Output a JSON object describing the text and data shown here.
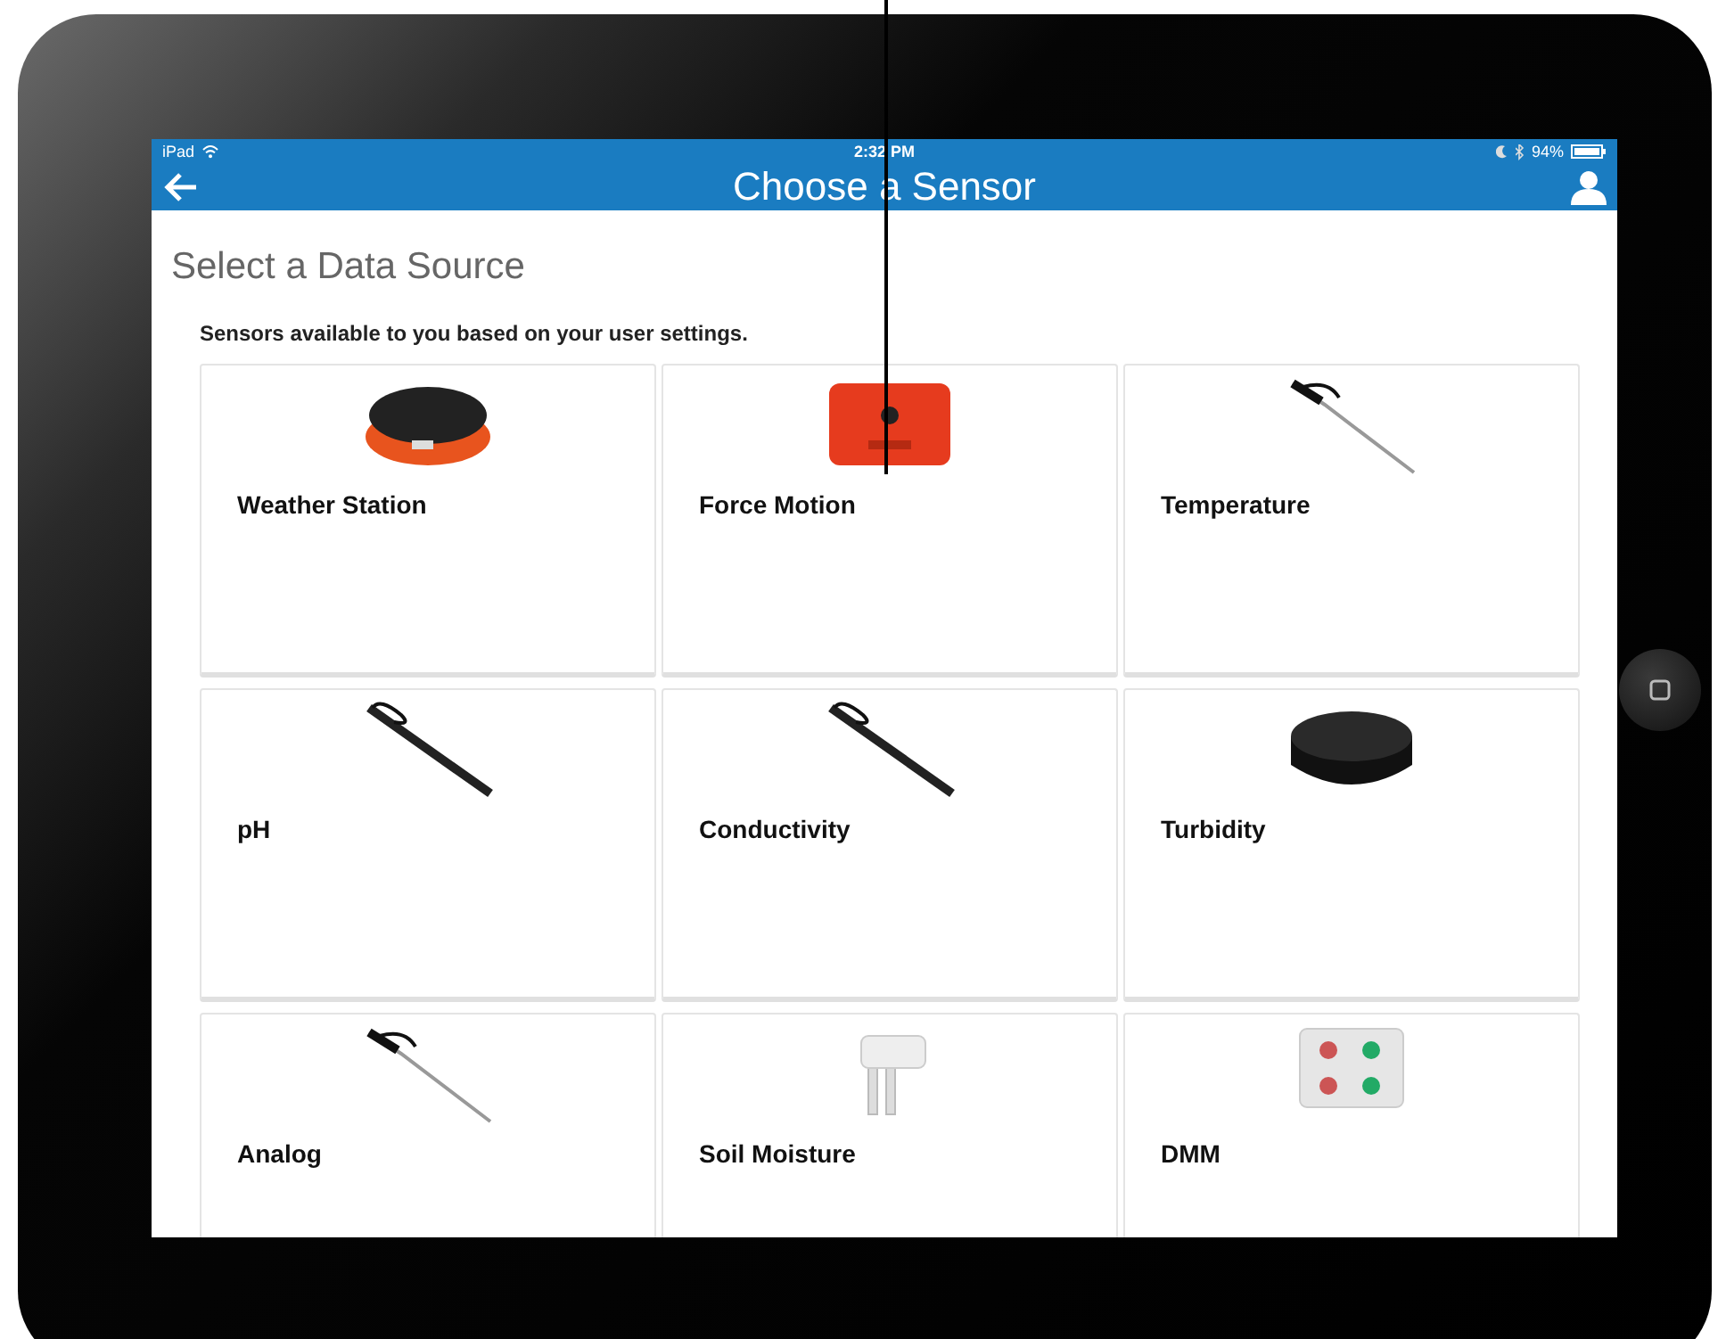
{
  "status_bar": {
    "device": "iPad",
    "time": "2:32 PM",
    "battery": "94%"
  },
  "header": {
    "title": "Choose a Sensor"
  },
  "page": {
    "title": "Select a Data Source",
    "subtitle": "Sensors available to you based on your user settings."
  },
  "sensors": [
    {
      "name": "Weather Station",
      "kind": "hub"
    },
    {
      "name": "Force Motion",
      "kind": "block"
    },
    {
      "name": "Temperature",
      "kind": "probe"
    },
    {
      "name": "pH",
      "kind": "cable"
    },
    {
      "name": "Conductivity",
      "kind": "cable"
    },
    {
      "name": "Turbidity",
      "kind": "puck"
    },
    {
      "name": "Analog",
      "kind": "probe"
    },
    {
      "name": "Soil Moisture",
      "kind": "fork"
    },
    {
      "name": "DMM",
      "kind": "meter"
    }
  ]
}
